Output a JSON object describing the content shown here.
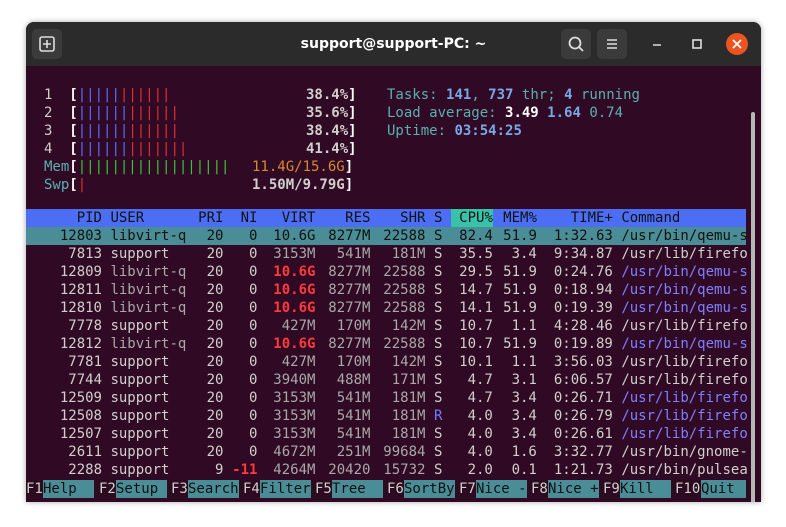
{
  "window": {
    "title": "support@support-PC: ~"
  },
  "cpus": [
    {
      "num": "1",
      "bar_b": "|||||",
      "bar_r": "||||||",
      "pct": "38.4%"
    },
    {
      "num": "2",
      "bar_b": "||||||",
      "bar_r": "||||||",
      "pct": "35.6%"
    },
    {
      "num": "3",
      "bar_b": "||||||",
      "bar_r": "||||||",
      "pct": "38.4%"
    },
    {
      "num": "4",
      "bar_b": "||||||",
      "bar_r": "|||||||",
      "pct": "41.4%"
    }
  ],
  "mem": {
    "label": "Mem",
    "bar": "||||||||||||||||||",
    "value": "11.4G/15.6G"
  },
  "swp": {
    "label": "Swp",
    "bar": "|",
    "value": "1.50M/9.79G"
  },
  "tasks": {
    "label": "Tasks:",
    "count": "141",
    "thr": "737",
    "thr_label": "thr;",
    "running": "4",
    "running_label": "running"
  },
  "load": {
    "label": "Load average:",
    "v1": "3.49",
    "v2": "1.64",
    "v3": "0.74"
  },
  "uptime": {
    "label": "Uptime:",
    "value": "03:54:25"
  },
  "columns": [
    "PID",
    "USER",
    "PRI",
    "NI",
    "VIRT",
    "RES",
    "SHR",
    "S",
    "CPU%",
    "MEM%",
    "TIME+",
    "Command"
  ],
  "processes": [
    {
      "pid": "12803",
      "user": "libvirt-q",
      "pri": "20",
      "ni": "0",
      "virt": "10.6G",
      "res": "8277M",
      "shr": "22588",
      "s": "S",
      "cpu": "82.4",
      "mem": "51.9",
      "time": "1:32.63",
      "cmd": "/usr/bin/qemu-s"
    },
    {
      "pid": "7813",
      "user": "support",
      "pri": "20",
      "ni": "0",
      "virt": "3153M",
      "res": "541M",
      "shr": "181M",
      "s": "S",
      "cpu": "35.5",
      "mem": "3.4",
      "time": "9:34.87",
      "cmd": "/usr/lib/firefo"
    },
    {
      "pid": "12809",
      "user": "libvirt-q",
      "pri": "20",
      "ni": "0",
      "virt": "10.6G",
      "res": "8277M",
      "shr": "22588",
      "s": "S",
      "cpu": "29.5",
      "mem": "51.9",
      "time": "0:24.76",
      "cmd": "/usr/bin/qemu-s"
    },
    {
      "pid": "12811",
      "user": "libvirt-q",
      "pri": "20",
      "ni": "0",
      "virt": "10.6G",
      "res": "8277M",
      "shr": "22588",
      "s": "S",
      "cpu": "14.7",
      "mem": "51.9",
      "time": "0:18.94",
      "cmd": "/usr/bin/qemu-s"
    },
    {
      "pid": "12810",
      "user": "libvirt-q",
      "pri": "20",
      "ni": "0",
      "virt": "10.6G",
      "res": "8277M",
      "shr": "22588",
      "s": "S",
      "cpu": "14.1",
      "mem": "51.9",
      "time": "0:19.39",
      "cmd": "/usr/bin/qemu-s"
    },
    {
      "pid": "7778",
      "user": "support",
      "pri": "20",
      "ni": "0",
      "virt": "427M",
      "res": "170M",
      "shr": "142M",
      "s": "S",
      "cpu": "10.7",
      "mem": "1.1",
      "time": "4:28.46",
      "cmd": "/usr/lib/firefo"
    },
    {
      "pid": "12812",
      "user": "libvirt-q",
      "pri": "20",
      "ni": "0",
      "virt": "10.6G",
      "res": "8277M",
      "shr": "22588",
      "s": "S",
      "cpu": "10.7",
      "mem": "51.9",
      "time": "0:19.89",
      "cmd": "/usr/bin/qemu-s"
    },
    {
      "pid": "7781",
      "user": "support",
      "pri": "20",
      "ni": "0",
      "virt": "427M",
      "res": "170M",
      "shr": "142M",
      "s": "S",
      "cpu": "10.1",
      "mem": "1.1",
      "time": "3:56.03",
      "cmd": "/usr/lib/firefo"
    },
    {
      "pid": "7744",
      "user": "support",
      "pri": "20",
      "ni": "0",
      "virt": "3940M",
      "res": "488M",
      "shr": "171M",
      "s": "S",
      "cpu": "4.7",
      "mem": "3.1",
      "time": "6:06.57",
      "cmd": "/usr/lib/firefo"
    },
    {
      "pid": "12509",
      "user": "support",
      "pri": "20",
      "ni": "0",
      "virt": "3153M",
      "res": "541M",
      "shr": "181M",
      "s": "S",
      "cpu": "4.7",
      "mem": "3.4",
      "time": "0:26.71",
      "cmd": "/usr/lib/firefo"
    },
    {
      "pid": "12508",
      "user": "support",
      "pri": "20",
      "ni": "0",
      "virt": "3153M",
      "res": "541M",
      "shr": "181M",
      "s": "R",
      "cpu": "4.0",
      "mem": "3.4",
      "time": "0:26.79",
      "cmd": "/usr/lib/firefo"
    },
    {
      "pid": "12507",
      "user": "support",
      "pri": "20",
      "ni": "0",
      "virt": "3153M",
      "res": "541M",
      "shr": "181M",
      "s": "S",
      "cpu": "4.0",
      "mem": "3.4",
      "time": "0:26.61",
      "cmd": "/usr/lib/firefo"
    },
    {
      "pid": "2611",
      "user": "support",
      "pri": "20",
      "ni": "0",
      "virt": "4672M",
      "res": "251M",
      "shr": "99684",
      "s": "S",
      "cpu": "4.0",
      "mem": "1.6",
      "time": "3:32.77",
      "cmd": "/usr/bin/gnome-"
    },
    {
      "pid": "2288",
      "user": "support",
      "pri": "9",
      "ni": "-11",
      "virt": "4264M",
      "res": "20420",
      "shr": "15732",
      "s": "S",
      "cpu": "2.0",
      "mem": "0.1",
      "time": "1:21.73",
      "cmd": "/usr/bin/pulsea"
    }
  ],
  "footer": [
    {
      "key": "F1",
      "label": "Help  "
    },
    {
      "key": "F2",
      "label": "Setup "
    },
    {
      "key": "F3",
      "label": "Search"
    },
    {
      "key": "F4",
      "label": "Filter"
    },
    {
      "key": "F5",
      "label": "Tree  "
    },
    {
      "key": "F6",
      "label": "SortBy"
    },
    {
      "key": "F7",
      "label": "Nice -"
    },
    {
      "key": "F8",
      "label": "Nice +"
    },
    {
      "key": "F9",
      "label": "Kill  "
    },
    {
      "key": "F10",
      "label": "Quit"
    }
  ],
  "colors": {
    "terminal_bg": "#300a24",
    "header_bg": "#4c6ef5",
    "selected_bg": "#4a8d96",
    "titlebar_bg": "#2b2b2b",
    "close_button": "#e95420"
  },
  "icons": [
    "new-tab-icon",
    "search-icon",
    "hamburger-menu-icon",
    "minimize-icon",
    "maximize-icon",
    "close-icon"
  ]
}
